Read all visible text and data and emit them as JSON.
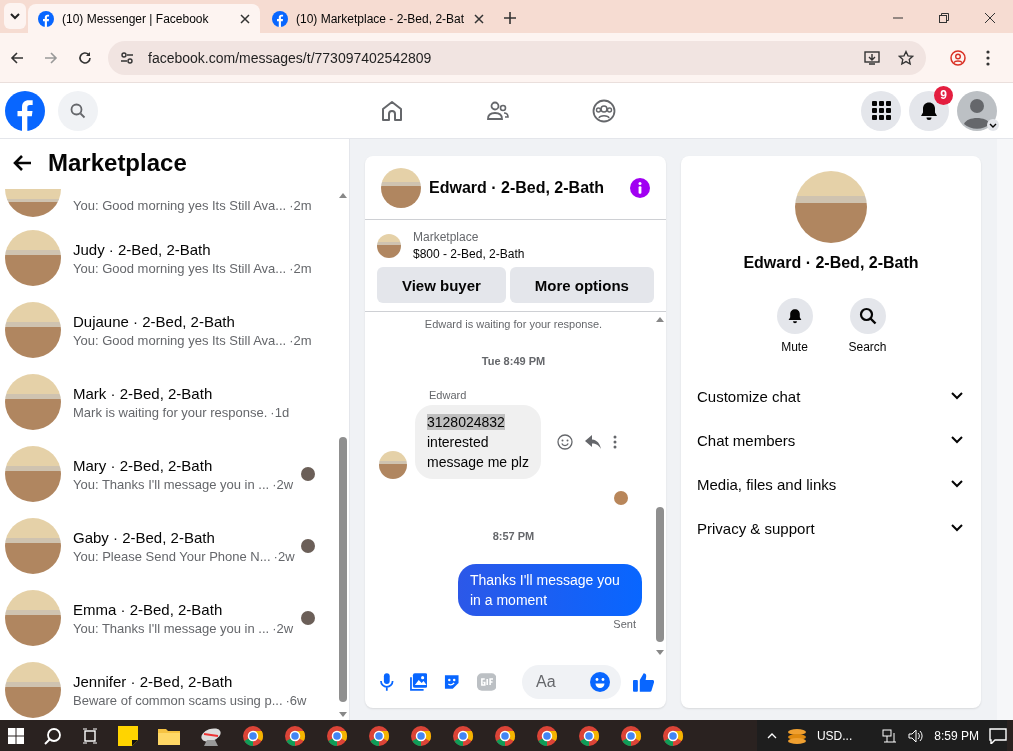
{
  "browser": {
    "tabs": [
      {
        "title": "(10) Messenger | Facebook",
        "selected": true
      },
      {
        "title": "(10) Marketplace - 2-Bed, 2-Bat",
        "selected": false
      }
    ],
    "address": "facebook.com/messages/t/773097402542809"
  },
  "header": {
    "notification_count": "9"
  },
  "sidebar": {
    "title": "Marketplace",
    "conversations": [
      {
        "kind": "partial",
        "preview": "You: Good morning yes Its Still Ava...",
        "time": "·2m",
        "seen": false
      },
      {
        "kind": "full",
        "name": "Judy · 2-Bed, 2-Bath",
        "preview": "You: Good morning yes Its Still Ava...",
        "time": "·2m",
        "seen": false
      },
      {
        "kind": "full",
        "name": "Dujaune · 2-Bed, 2-Bath",
        "preview": "You: Good morning yes Its Still Ava...",
        "time": "·2m",
        "seen": false
      },
      {
        "kind": "full",
        "name": "Mark · 2-Bed, 2-Bath",
        "preview": "Mark is waiting for your response.",
        "time": "·1d",
        "seen": false
      },
      {
        "kind": "full",
        "name": "Mary · 2-Bed, 2-Bath",
        "preview": "You: Thanks I'll message you in ...",
        "time": "·2w",
        "seen": true
      },
      {
        "kind": "full",
        "name": "Gaby · 2-Bed, 2-Bath",
        "preview": "You: Please Send Your Phone N...",
        "time": "·2w",
        "seen": true
      },
      {
        "kind": "full",
        "name": "Emma · 2-Bed, 2-Bath",
        "preview": "You: Thanks I'll message you in ...",
        "time": "·2w",
        "seen": true
      },
      {
        "kind": "full",
        "name": "Jennifer · 2-Bed, 2-Bath",
        "preview": "Beware of common scams using p...",
        "time": "·6w",
        "seen": false
      }
    ]
  },
  "chat": {
    "title": "Edward · 2-Bed, 2-Bath",
    "listing": {
      "label": "Marketplace",
      "price": "$800 - 2-Bed, 2-Bath"
    },
    "buttons": [
      "View buyer",
      "More options"
    ],
    "messages": [
      {
        "kind": "notice",
        "text": "Edward is waiting for your response."
      },
      {
        "kind": "time",
        "text": "Tue 8:49 PM"
      },
      {
        "kind": "incoming",
        "sender": "Edward",
        "lines": [
          {
            "text": "3128024832",
            "highlighted": true
          },
          {
            "text": "interested",
            "highlighted": false
          },
          {
            "text": "message me plz",
            "highlighted": false
          }
        ]
      },
      {
        "kind": "receipt"
      },
      {
        "kind": "time",
        "text": "8:57 PM"
      },
      {
        "kind": "outgoing",
        "text": "Thanks I'll message you in a moment",
        "status": "Sent"
      }
    ],
    "composer": {
      "placeholder": "Aa"
    }
  },
  "details": {
    "name": "Edward · 2-Bed, 2-Bath",
    "actions": [
      {
        "kind": "mute",
        "label": "Mute"
      },
      {
        "kind": "search",
        "label": "Search"
      }
    ],
    "sections": [
      {
        "label": "Customize chat",
        "expanded": false
      },
      {
        "label": "Chat members",
        "expanded": false
      },
      {
        "label": "Media, files and links",
        "expanded": false
      },
      {
        "label": "Privacy & support",
        "expanded": false
      }
    ]
  },
  "taskbar": {
    "tray_label": "USD...",
    "time": "8:59 PM"
  }
}
